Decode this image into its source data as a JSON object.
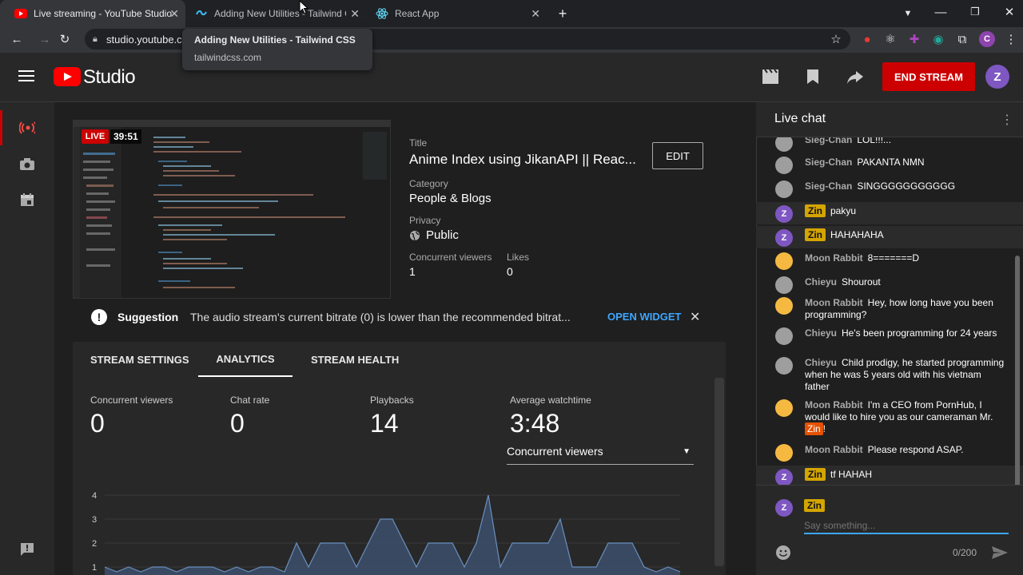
{
  "browser": {
    "tabs": [
      {
        "title": "Live streaming - YouTube Studio",
        "active": true
      },
      {
        "title": "Adding New Utilities - Tailwind C",
        "active": false
      },
      {
        "title": "React App",
        "active": false
      }
    ],
    "url": "studio.youtube.c",
    "tooltip_title": "Adding New Utilities - Tailwind CSS",
    "tooltip_domain": "tailwindcss.com",
    "profile_initial": "C"
  },
  "header": {
    "logo_text": "Studio",
    "end_stream_label": "END STREAM",
    "avatar_initial": "Z"
  },
  "stream": {
    "live_label": "LIVE",
    "duration": "39:51",
    "title_label": "Title",
    "title": "Anime Index using JikanAPI || Reac...",
    "edit_label": "EDIT",
    "category_label": "Category",
    "category": "People & Blogs",
    "privacy_label": "Privacy",
    "privacy": "Public",
    "viewers_label": "Concurrent viewers",
    "viewers": "1",
    "likes_label": "Likes",
    "likes": "0"
  },
  "suggestion": {
    "label": "Suggestion",
    "text": "The audio stream's current bitrate (0) is lower than the recommended bitrat...",
    "action": "OPEN WIDGET"
  },
  "tabs": [
    {
      "label": "STREAM SETTINGS",
      "active": false
    },
    {
      "label": "ANALYTICS",
      "active": true
    },
    {
      "label": "STREAM HEALTH",
      "active": false
    }
  ],
  "analytics": {
    "stats": [
      {
        "label": "Concurrent viewers",
        "value": "0"
      },
      {
        "label": "Chat rate",
        "value": "0"
      },
      {
        "label": "Playbacks",
        "value": "14"
      },
      {
        "label": "Average watchtime",
        "value": "3:48"
      }
    ],
    "dropdown_value": "Concurrent viewers",
    "chart_yticks": [
      "4",
      "3",
      "2",
      "1"
    ]
  },
  "chart_data": {
    "type": "area",
    "title": "",
    "xlabel": "",
    "ylabel": "",
    "ylim": [
      1,
      4
    ],
    "values": [
      1,
      0.8,
      1,
      0.8,
      1,
      1,
      0.8,
      1,
      1,
      1,
      0.8,
      1,
      0.8,
      1,
      1,
      0.8,
      2,
      1,
      2,
      2,
      2,
      1,
      2,
      3,
      3,
      2,
      1,
      2,
      2,
      2,
      1,
      2,
      4,
      1,
      2,
      2,
      2,
      2,
      3,
      1,
      1,
      1,
      2,
      2,
      2,
      1,
      0.8,
      1,
      0.8
    ]
  },
  "chat": {
    "title": "Live chat",
    "messages": [
      {
        "author": "Sieg-Chan",
        "text": "LOL!!!...",
        "owner": false,
        "avatar": "grey"
      },
      {
        "author": "Sieg-Chan",
        "text": "PAKANTA NMN",
        "owner": false,
        "avatar": "grey"
      },
      {
        "author": "Sieg-Chan",
        "text": "SINGGGGGGGGGGG",
        "owner": false,
        "avatar": "grey"
      },
      {
        "author": "Zin",
        "text": "pakyu",
        "owner": true,
        "avatar": "Z"
      },
      {
        "author": "Zin",
        "text": "HAHAHAHA",
        "owner": true,
        "avatar": "Z"
      },
      {
        "author": "Moon Rabbit",
        "text": "8=======D",
        "owner": false,
        "avatar": "gold"
      },
      {
        "author": "Chieyu",
        "text": "Shourout",
        "owner": false,
        "avatar": "grey"
      },
      {
        "author": "Moon Rabbit",
        "text": "Hey, how long have you been programming?",
        "owner": false,
        "avatar": "gold"
      },
      {
        "author": "Chieyu",
        "text": "He's been programming for 24 years",
        "owner": false,
        "avatar": "grey"
      },
      {
        "author": "Chieyu",
        "text": "Child prodigy, he started programming when he was 5 years old with his vietnam father",
        "owner": false,
        "avatar": "grey"
      },
      {
        "author": "Moon Rabbit",
        "text": "I'm a CEO from PornHub, I would like to hire you as our cameraman Mr.",
        "mention": "Zin",
        "mention_suffix": "!",
        "owner": false,
        "avatar": "gold"
      },
      {
        "author": "Moon Rabbit",
        "text": "Please respond ASAP.",
        "owner": false,
        "avatar": "gold"
      },
      {
        "author": "Zin",
        "text": "tf HAHAH",
        "owner": true,
        "avatar": "Z"
      }
    ],
    "input_user": "Zin",
    "input_placeholder": "Say something...",
    "char_count": "0/200"
  },
  "colors": {
    "accent_red": "#cc0000",
    "link_blue": "#3ea6ff",
    "owner_badge": "#d4a500",
    "chart_fill": "#3c4f6b",
    "chart_line": "#6a8fbf"
  }
}
